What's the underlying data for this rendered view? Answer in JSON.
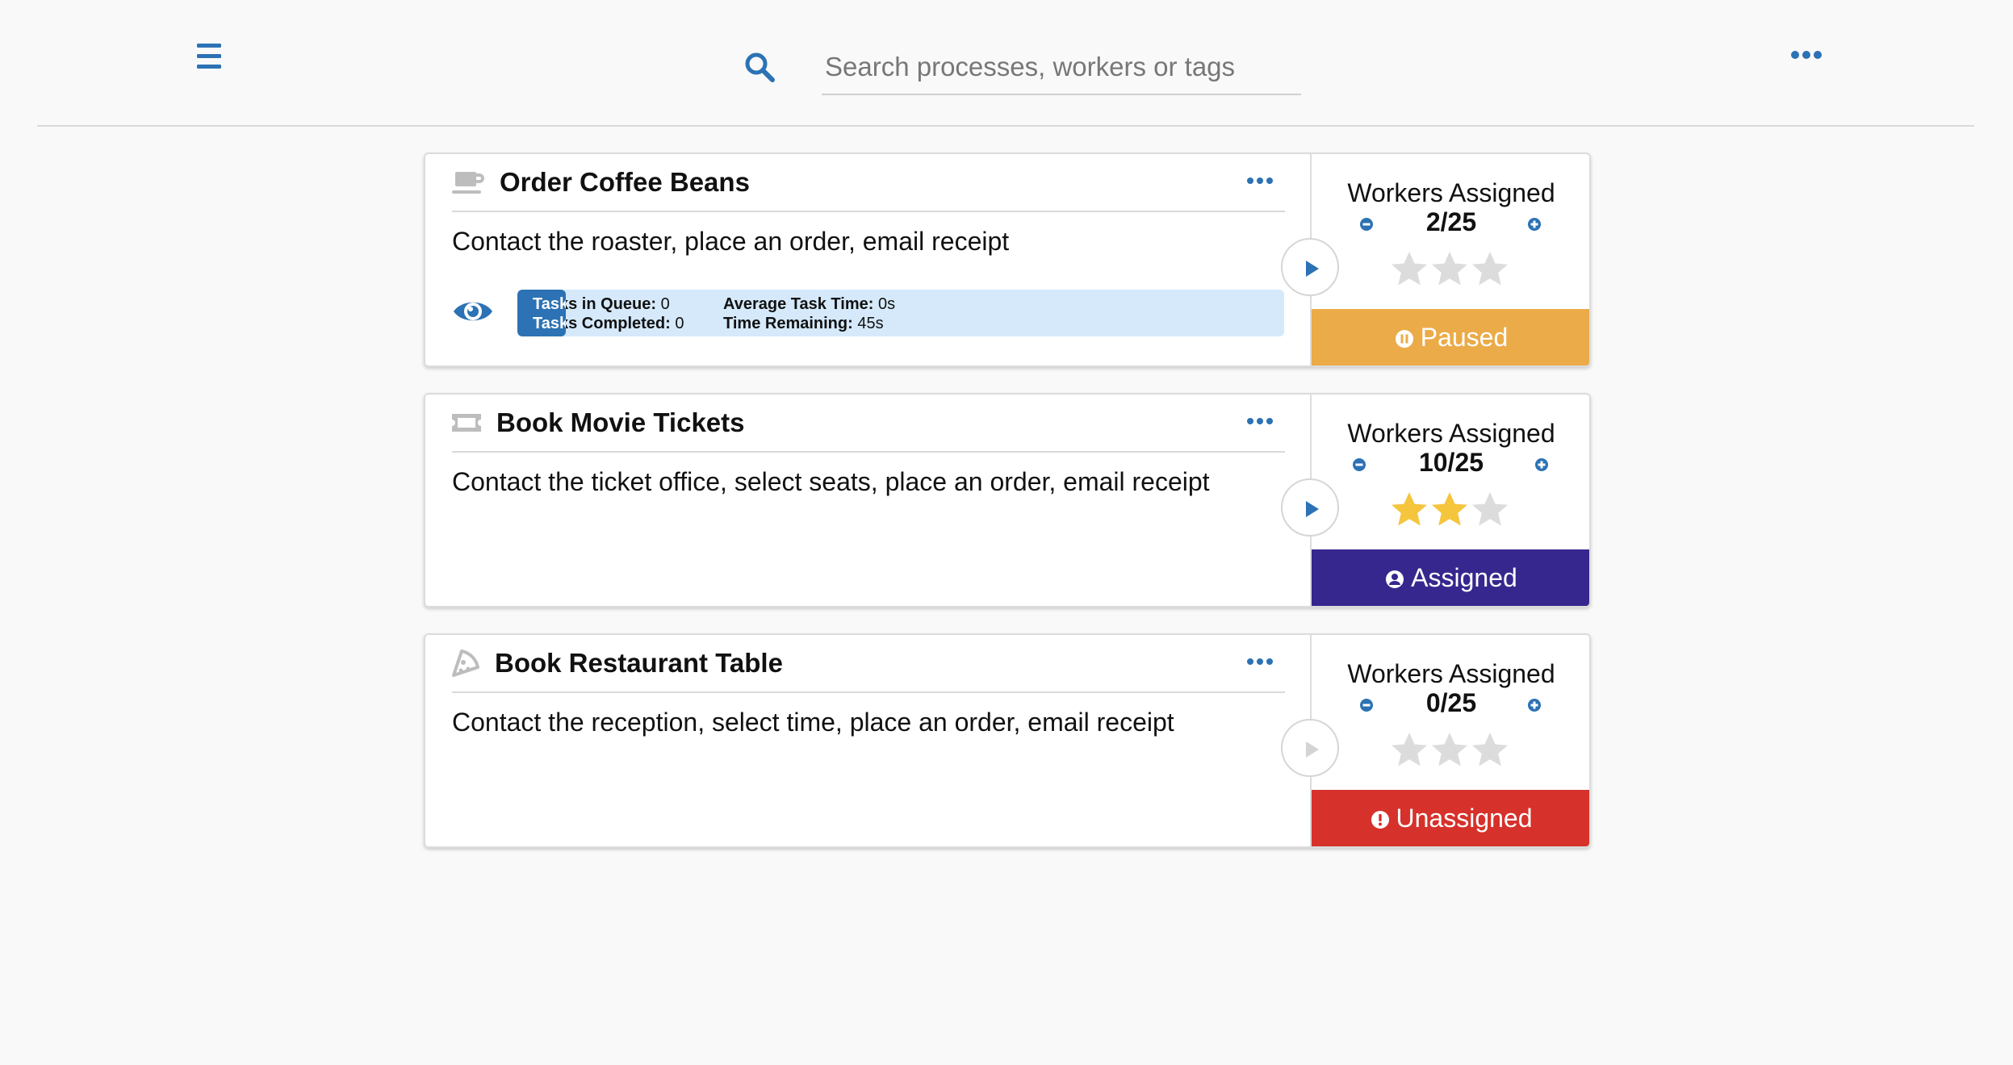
{
  "toolbar": {
    "menu_icon": "hamburger-menu-icon",
    "search": {
      "icon": "search-icon",
      "placeholder": "Search processes, workers or tags",
      "value": ""
    },
    "more_icon": "horizontal-ellipsis-icon"
  },
  "colors": {
    "accent": "#2c72b4",
    "star_filled": "#f5c53d",
    "star_empty": "#dcdcdc",
    "paused": "#ebab48",
    "assigned": "#36278e",
    "unassigned": "#d6312b",
    "stats_bg": "#d5e9fa"
  },
  "processes": [
    {
      "icon": "coffee-cup-icon",
      "title": "Order Coffee Beans",
      "description": "Contact the roaster, place an order, email receipt",
      "show_stats": true,
      "stats": {
        "tasks_in_queue_label": "Tasks in Queue:",
        "tasks_in_queue": "0",
        "tasks_completed_label": "Tasks Completed:",
        "tasks_completed": "0",
        "avg_task_time_label": "Average Task Time:",
        "avg_task_time": "0s",
        "time_remaining_label": "Time Remaining:",
        "time_remaining": "45s",
        "progress_fraction": 0.063
      },
      "play_enabled": true,
      "workers_label": "Workers Assigned",
      "workers": "2/25",
      "rating": 0,
      "rating_max": 3,
      "status": "Paused",
      "status_icon": "pause-circle-icon",
      "status_color": "#ebab48"
    },
    {
      "icon": "ticket-icon",
      "title": "Book Movie Tickets",
      "description": "Contact the ticket office, select seats, place an order, email receipt",
      "show_stats": false,
      "play_enabled": true,
      "workers_label": "Workers Assigned",
      "workers": "10/25",
      "rating": 2,
      "rating_max": 3,
      "status": "Assigned",
      "status_icon": "user-circle-icon",
      "status_color": "#36278e"
    },
    {
      "icon": "pizza-slice-icon",
      "title": "Book Restaurant Table",
      "description": "Contact the reception, select time, place an order, email receipt",
      "show_stats": false,
      "play_enabled": false,
      "workers_label": "Workers Assigned",
      "workers": "0/25",
      "rating": 0,
      "rating_max": 3,
      "status": "Unassigned",
      "status_icon": "exclamation-circle-icon",
      "status_color": "#d6312b"
    }
  ]
}
